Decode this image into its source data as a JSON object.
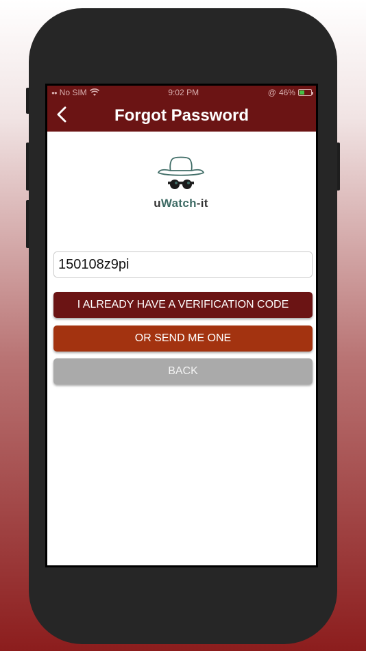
{
  "colors": {
    "header": "#6b1414",
    "primary_button": "#6b1414",
    "secondary_button": "#a33310",
    "back_button": "#aaaaaa",
    "battery": "#45c045"
  },
  "status_bar": {
    "carrier": "No SIM",
    "time": "9:02 PM",
    "battery_percent": "46%",
    "battery_level": 0.46,
    "icons": [
      "signal-icon",
      "wifi-icon",
      "orientation-lock-icon",
      "battery-icon"
    ]
  },
  "nav": {
    "title": "Forgot Password",
    "back_icon": "chevron-left-icon"
  },
  "logo": {
    "text_prefix": "u",
    "text_mid": "Watch",
    "text_suffix": "-it",
    "icon": "spy-hat-glasses-icon"
  },
  "form": {
    "username_value": "150108z9pi",
    "verify_button": "I already have a verification code",
    "send_button": "Or send me one",
    "back_button": "Back"
  }
}
